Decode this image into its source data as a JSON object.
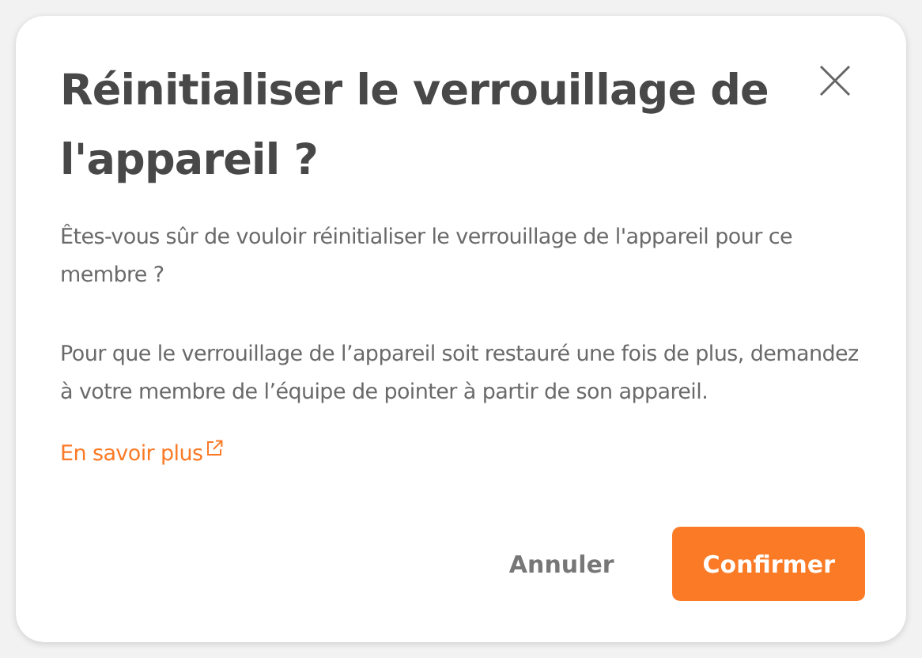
{
  "dialog": {
    "title": "Réinitialiser le verrouillage de l'appareil ?",
    "paragraphs": [
      "Êtes-vous sûr de vouloir réinitialiser le verrouillage de l'appareil pour ce membre ?",
      "Pour que le verrouillage de l’appareil soit restauré une fois de plus, demandez à votre membre de l’équipe de pointer à partir de son appareil."
    ],
    "link": "En savoir plus",
    "buttons": [
      {
        "label": "Annuler",
        "kind": "secondary"
      },
      {
        "label": "Confirmer",
        "kind": "primary"
      }
    ]
  }
}
